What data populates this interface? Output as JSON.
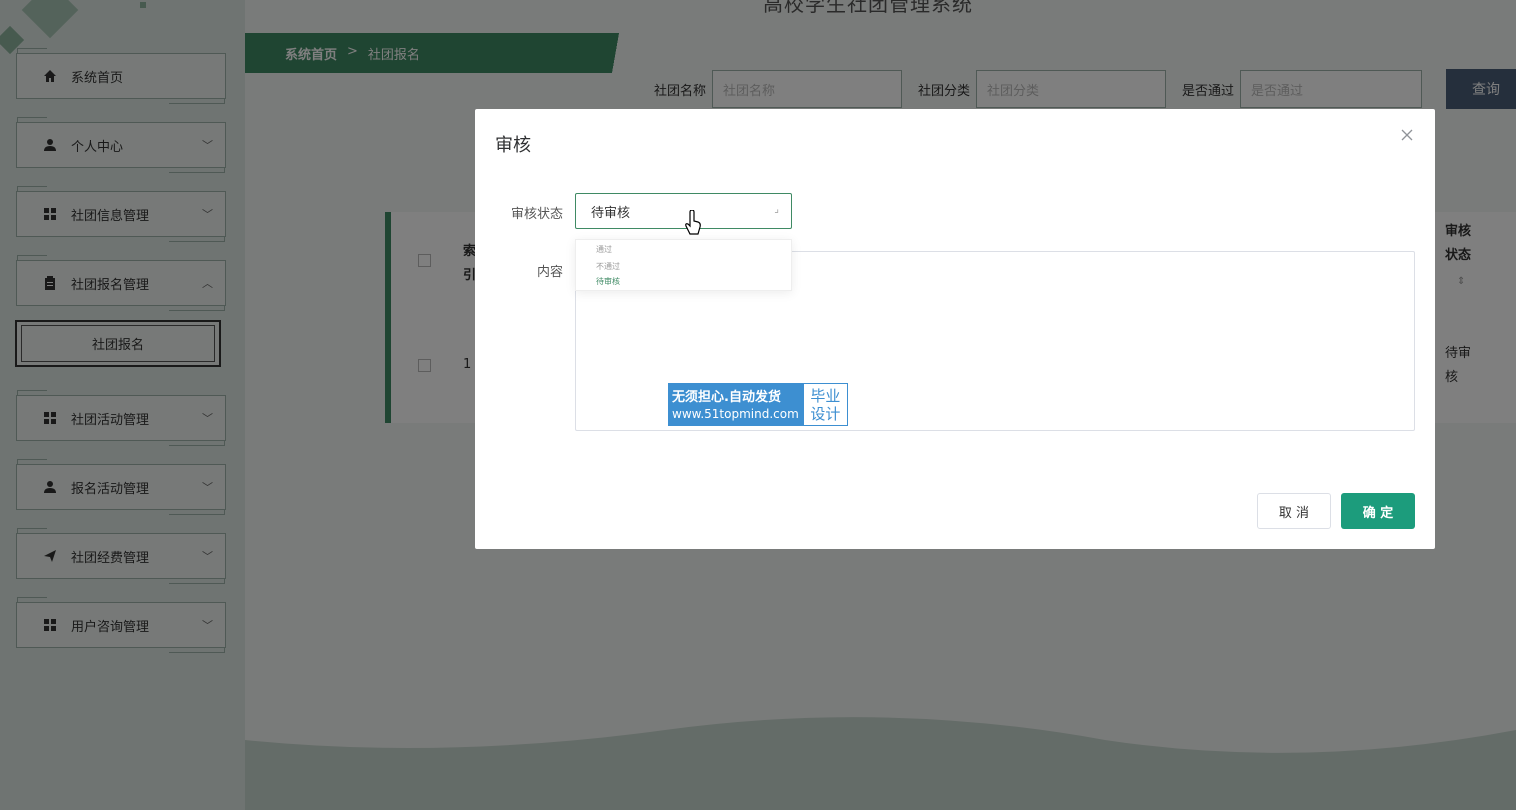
{
  "app": {
    "title": "高校学生社团管理系统"
  },
  "sidebar": {
    "items": [
      {
        "label": "系统首页",
        "icon": "home-icon"
      },
      {
        "label": "个人中心",
        "icon": "user-icon"
      },
      {
        "label": "社团信息管理",
        "icon": "grid-icon"
      },
      {
        "label": "社团报名管理",
        "icon": "clipboard-icon"
      },
      {
        "label": "社团活动管理",
        "icon": "grid-icon"
      },
      {
        "label": "报名活动管理",
        "icon": "user-icon"
      },
      {
        "label": "社团经费管理",
        "icon": "send-icon"
      },
      {
        "label": "用户咨询管理",
        "icon": "grid-icon"
      }
    ],
    "sub_item": "社团报名"
  },
  "breadcrumb": {
    "home": "系统首页",
    "separator": ">",
    "current": "社团报名"
  },
  "search": {
    "name_label": "社团名称",
    "name_placeholder": "社团名称",
    "category_label": "社团分类",
    "category_placeholder": "社团分类",
    "passed_label": "是否通过",
    "passed_placeholder": "是否通过",
    "query_label": "查询"
  },
  "table": {
    "header_col1": "索引",
    "header_status": "审核状态",
    "row_index": "1",
    "row_status": "待审核"
  },
  "modal": {
    "title": "审核",
    "status_label": "审核状态",
    "status_value": "待审核",
    "content_label": "内容",
    "options": [
      "通过",
      "不通过",
      "待审核"
    ],
    "cancel_label": "取 消",
    "ok_label": "确 定"
  },
  "watermark": {
    "line1": "无须担心.自动发货",
    "line2": "www.51topmind.com",
    "right1": "毕业",
    "right2": "设计"
  },
  "colors": {
    "accent": "#3f8a64",
    "confirm": "#1c9c7c",
    "badge": "#3d8fd1"
  }
}
